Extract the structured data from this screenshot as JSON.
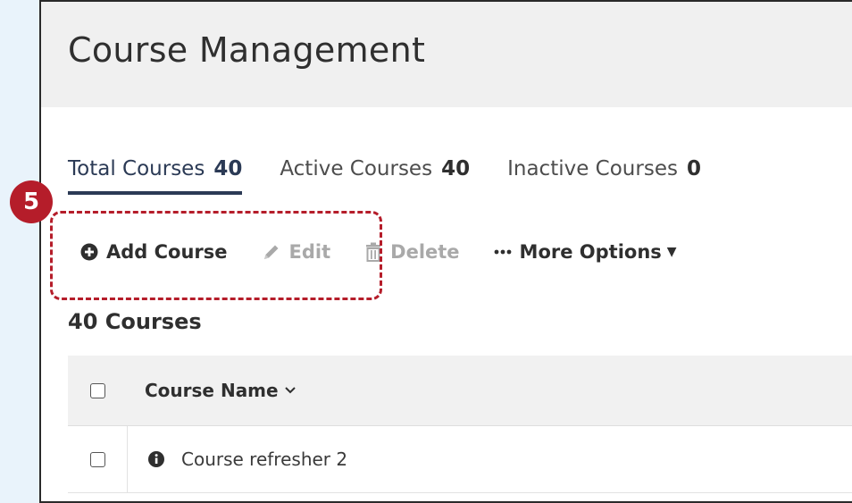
{
  "page": {
    "title": "Course Management"
  },
  "tabs": [
    {
      "label": "Total Courses",
      "count": "40"
    },
    {
      "label": "Active Courses",
      "count": "40"
    },
    {
      "label": "Inactive Courses",
      "count": "0"
    }
  ],
  "toolbar": {
    "add_label": "Add Course",
    "edit_label": "Edit",
    "delete_label": "Delete",
    "more_label": "More Options"
  },
  "annotation": {
    "step": "5"
  },
  "list": {
    "count_label": "40 Courses"
  },
  "table": {
    "columns": [
      "Course Name"
    ],
    "rows": [
      {
        "name": "Course refresher 2"
      }
    ]
  },
  "colors": {
    "accent": "#2b3a55",
    "highlight": "#b51d2a",
    "disabled": "#a9a9a9"
  }
}
